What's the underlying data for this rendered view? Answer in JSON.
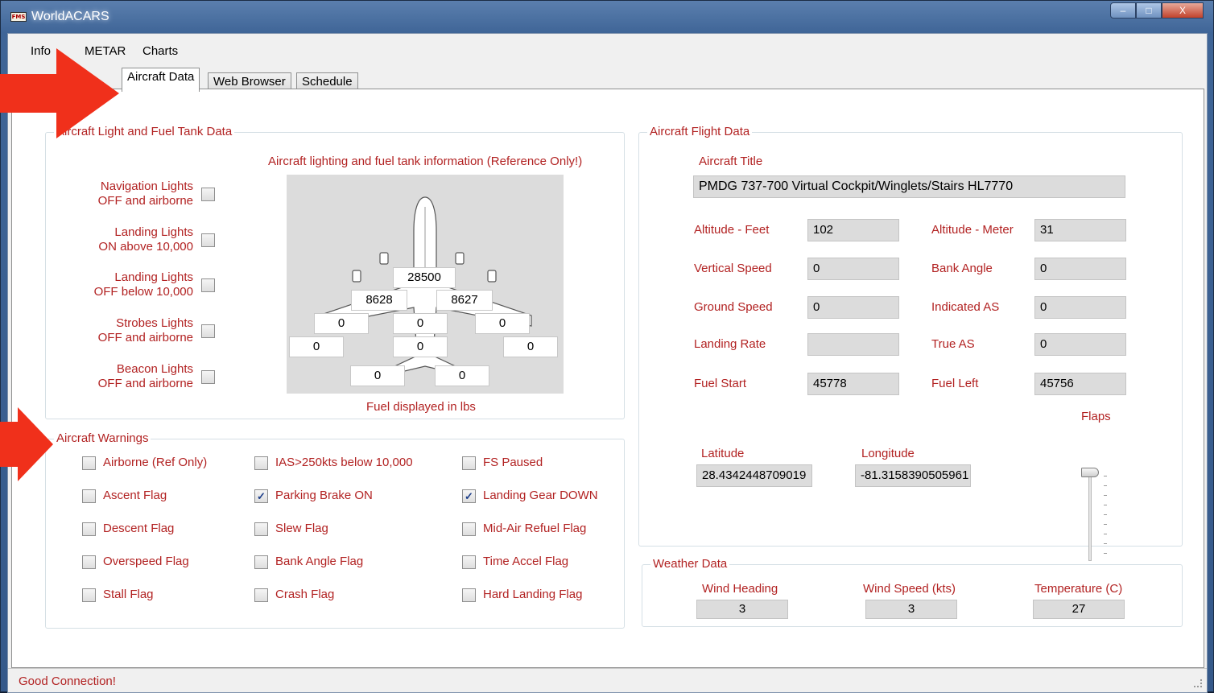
{
  "window": {
    "title": "WorldACARS",
    "app_icon_text": "FMS"
  },
  "window_controls": {
    "minimize": "–",
    "maximize": "□",
    "close": "X"
  },
  "menu": [
    "Info",
    "METAR",
    "Charts"
  ],
  "tabs": [
    {
      "label": "Aircraft Data",
      "active": true
    },
    {
      "label": "Web Browser",
      "active": false
    },
    {
      "label": "Schedule",
      "active": false
    }
  ],
  "lights_group": {
    "title": "Aircraft Light and Fuel Tank Data",
    "items": [
      {
        "line1": "Navigation Lights",
        "line2": "OFF and airborne",
        "checked": false
      },
      {
        "line1": "Landing Lights",
        "line2": "ON above 10,000",
        "checked": false
      },
      {
        "line1": "Landing Lights",
        "line2": "OFF below 10,000",
        "checked": false
      },
      {
        "line1": "Strobes Lights",
        "line2": "OFF and airborne",
        "checked": false
      },
      {
        "line1": "Beacon Lights",
        "line2": "OFF and airborne",
        "checked": false
      }
    ],
    "fuel_heading": "Aircraft lighting and fuel tank information (Reference Only!)",
    "fuel_note": "Fuel displayed in lbs",
    "tanks": {
      "center": "28500",
      "left_main": "8628",
      "right_main": "8627",
      "left_aux": "0",
      "center_aux": "0",
      "right_aux": "0",
      "left_tip": "0",
      "center_lower": "0",
      "right_tip": "0",
      "ext1": "0",
      "ext2": "0"
    }
  },
  "warnings_group": {
    "title": "Aircraft Warnings",
    "columns": [
      [
        {
          "label": "Airborne (Ref Only)",
          "checked": false
        },
        {
          "label": "Ascent Flag",
          "checked": false
        },
        {
          "label": "Descent Flag",
          "checked": false
        },
        {
          "label": "Overspeed Flag",
          "checked": false
        },
        {
          "label": "Stall Flag",
          "checked": false
        }
      ],
      [
        {
          "label": "IAS>250kts below 10,000",
          "checked": false
        },
        {
          "label": "Parking Brake ON",
          "checked": true
        },
        {
          "label": "Slew Flag",
          "checked": false
        },
        {
          "label": "Bank Angle Flag",
          "checked": false
        },
        {
          "label": "Crash Flag",
          "checked": false
        }
      ],
      [
        {
          "label": "FS Paused",
          "checked": false
        },
        {
          "label": "Landing Gear DOWN",
          "checked": true
        },
        {
          "label": "Mid-Air Refuel Flag",
          "checked": false
        },
        {
          "label": "Time Accel Flag",
          "checked": false
        },
        {
          "label": "Hard Landing Flag",
          "checked": false
        }
      ]
    ]
  },
  "flight_group": {
    "title": "Aircraft Flight Data",
    "aircraft_title_label": "Aircraft Title",
    "aircraft_title": "PMDG 737-700 Virtual Cockpit/Winglets/Stairs HL7770",
    "rows": [
      {
        "left_label": "Altitude - Feet",
        "left_value": "102",
        "right_label": "Altitude - Meter",
        "right_value": "31"
      },
      {
        "left_label": "Vertical Speed",
        "left_value": "0",
        "right_label": "Bank Angle",
        "right_value": "0"
      },
      {
        "left_label": "Ground Speed",
        "left_value": "0",
        "right_label": "Indicated AS",
        "right_value": "0"
      },
      {
        "left_label": "Landing Rate",
        "left_value": "",
        "right_label": "True AS",
        "right_value": "0"
      },
      {
        "left_label": "Fuel Start",
        "left_value": "45778",
        "right_label": "Fuel Left",
        "right_value": "45756"
      }
    ],
    "flaps_label": "Flaps",
    "flaps_setting": 0,
    "latitude_label": "Latitude",
    "latitude": "28.4342448709019",
    "longitude_label": "Longitude",
    "longitude": "-81.3158390505961"
  },
  "weather_group": {
    "title": "Weather Data",
    "wind_heading_label": "Wind Heading",
    "wind_heading": "3",
    "wind_speed_label": "Wind Speed (kts)",
    "wind_speed": "3",
    "temperature_label": "Temperature (C)",
    "temperature": "27"
  },
  "status": {
    "text": "Good Connection!"
  },
  "colors": {
    "label_red": "#b22222",
    "arrow_red": "#f0301b",
    "field_grey": "#dcdcdc"
  }
}
